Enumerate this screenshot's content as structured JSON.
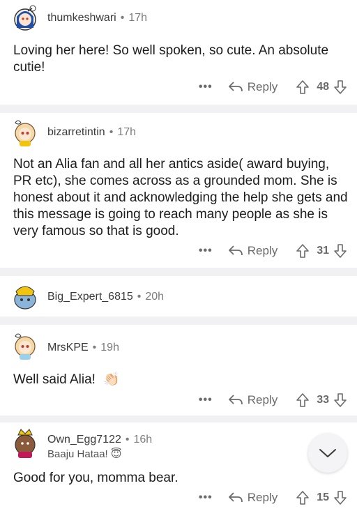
{
  "comments": [
    {
      "username": "thumkeshwari",
      "separator": "•",
      "time": "17h",
      "text": "Loving her here! So well spoken, so cute. An absolute cutie!",
      "more": "•••",
      "reply": "Reply",
      "votes": "48"
    },
    {
      "username": "bizarretintin",
      "separator": "•",
      "time": "17h",
      "text": "Not an Alia fan and all her antics aside( award buying, PR etc), she comes across as a grounded mom. She is honest about it and acknowledging the help she gets and this message is going to reach many people as she is very famous so that is good.",
      "more": "•••",
      "reply": "Reply",
      "votes": "31"
    },
    {
      "username": "Big_Expert_6815",
      "separator": "•",
      "time": "20h"
    },
    {
      "username": "MrsKPE",
      "separator": "•",
      "time": "19h",
      "text": "Well said Alia!",
      "emoji": "👏🏻",
      "more": "•••",
      "reply": "Reply",
      "votes": "33"
    },
    {
      "username": "Own_Egg7122",
      "separator": "•",
      "time": "16h",
      "flair": "Baaju Hataa! 😇",
      "text": "Good for you, momma bear.",
      "more": "•••",
      "reply": "Reply",
      "votes": "15"
    }
  ],
  "icons": {
    "reply": "reply-arrow-icon",
    "upvote": "upvote-arrow-icon",
    "downvote": "downvote-arrow-icon",
    "scroll": "chevron-down-icon"
  },
  "colors": {
    "divider": "#f1f1f3",
    "meta": "#7c7c7c",
    "action": "#6a6a6a"
  }
}
